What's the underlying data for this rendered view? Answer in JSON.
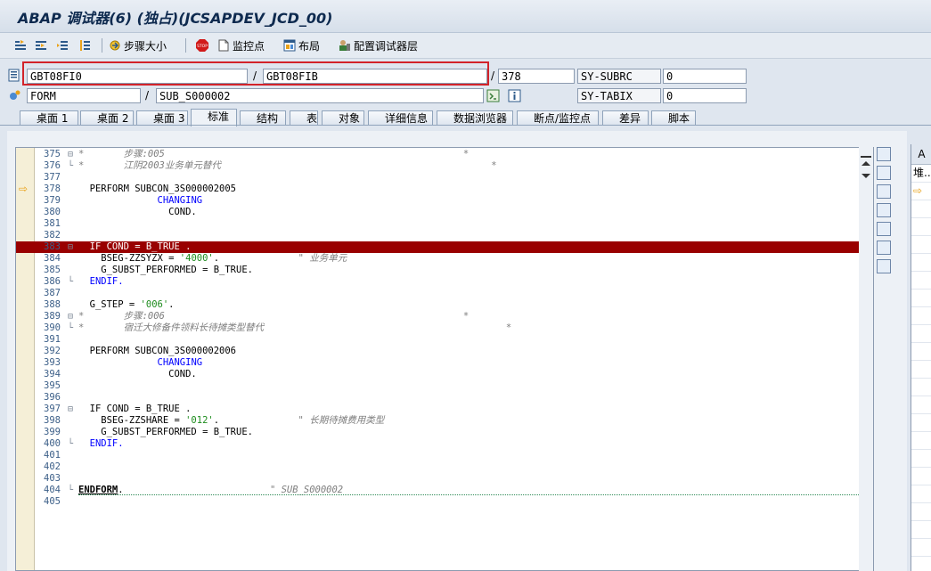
{
  "window": {
    "title": "ABAP 调试器(6) (独占)(JCSAPDEV_JCD_00)"
  },
  "toolbar": {
    "buttons": [
      {
        "label": "",
        "icon": "single-step-icon"
      },
      {
        "label": "",
        "icon": "execute-step-icon"
      },
      {
        "label": "",
        "icon": "return-icon"
      },
      {
        "label": "",
        "icon": "continue-icon"
      },
      {
        "label": "步骤大小",
        "icon": "step-size-icon"
      },
      {
        "label": "",
        "icon": "stop-icon"
      },
      {
        "label": "监控点",
        "icon": "watchpoint-icon"
      },
      {
        "label": "布局",
        "icon": "layout-icon"
      },
      {
        "label": "配置调试器层",
        "icon": "configure-layer-icon"
      }
    ]
  },
  "context": {
    "program": "GBT08FI0",
    "include": "GBT08FIB",
    "line": "378",
    "event_type": "FORM",
    "event_name": "SUB_S000002",
    "sys_fields": [
      {
        "name": "SY-SUBRC",
        "value": "0"
      },
      {
        "name": "SY-TABIX",
        "value": "0"
      }
    ]
  },
  "tabs": [
    {
      "label": "桌面 1",
      "active": false
    },
    {
      "label": "桌面 2",
      "active": false
    },
    {
      "label": "桌面 3",
      "active": false
    },
    {
      "label": "标准",
      "active": true
    },
    {
      "label": "结构",
      "active": false
    },
    {
      "label": "表",
      "active": false
    },
    {
      "label": "对象",
      "active": false
    },
    {
      "label": "详细信息",
      "active": false
    },
    {
      "label": "数据浏览器",
      "active": false
    },
    {
      "label": "断点/监控点",
      "active": false
    },
    {
      "label": "差异",
      "active": false
    },
    {
      "label": "脚本",
      "active": false
    }
  ],
  "code": {
    "current_line": 378,
    "breakpoint_line": 383,
    "highlight_line": 383,
    "lines": [
      {
        "n": "375",
        "fold": "⊟",
        "segs": [
          {
            "t": "*       步骤:005                                                     *",
            "c": "cmt"
          }
        ]
      },
      {
        "n": "376",
        "fold": "└",
        "segs": [
          {
            "t": "*       江阴2003业务单元替代                                                *",
            "c": "cmt"
          }
        ]
      },
      {
        "n": "377",
        "fold": "",
        "segs": []
      },
      {
        "n": "378",
        "fold": "",
        "segs": [
          {
            "t": "  PERFORM SUBCON_3S000002005",
            "c": ""
          }
        ]
      },
      {
        "n": "379",
        "fold": "",
        "segs": [
          {
            "t": "              ",
            "c": ""
          },
          {
            "t": "CHANGING",
            "c": "kw"
          }
        ]
      },
      {
        "n": "380",
        "fold": "",
        "segs": [
          {
            "t": "                COND.",
            "c": ""
          }
        ]
      },
      {
        "n": "381",
        "fold": "",
        "segs": []
      },
      {
        "n": "382",
        "fold": "",
        "segs": []
      },
      {
        "n": "383",
        "fold": "⊟",
        "segs": [
          {
            "t": "  IF COND = B_TRUE .",
            "c": ""
          }
        ]
      },
      {
        "n": "384",
        "fold": "",
        "segs": [
          {
            "t": "    BSEG-ZZSYZX = ",
            "c": ""
          },
          {
            "t": "'4000'",
            "c": "str"
          },
          {
            "t": ".              ",
            "c": ""
          },
          {
            "t": "\" 业务单元",
            "c": "cmt"
          }
        ]
      },
      {
        "n": "385",
        "fold": "",
        "segs": [
          {
            "t": "    G_SUBST_PERFORMED = B_TRUE.",
            "c": ""
          }
        ]
      },
      {
        "n": "386",
        "fold": "└",
        "segs": [
          {
            "t": "  ENDIF.",
            "c": "kw"
          }
        ]
      },
      {
        "n": "387",
        "fold": "",
        "segs": []
      },
      {
        "n": "388",
        "fold": "",
        "segs": [
          {
            "t": "  G_STEP = ",
            "c": ""
          },
          {
            "t": "'006'",
            "c": "str"
          },
          {
            "t": ".",
            "c": ""
          }
        ]
      },
      {
        "n": "389",
        "fold": "⊟",
        "segs": [
          {
            "t": "*       步骤:006                                                     *",
            "c": "cmt"
          }
        ]
      },
      {
        "n": "390",
        "fold": "└",
        "segs": [
          {
            "t": "*       宿迁大修备件领料长待摊类型替代                                           *",
            "c": "cmt"
          }
        ]
      },
      {
        "n": "391",
        "fold": "",
        "segs": []
      },
      {
        "n": "392",
        "fold": "",
        "segs": [
          {
            "t": "  PERFORM SUBCON_3S000002006",
            "c": ""
          }
        ]
      },
      {
        "n": "393",
        "fold": "",
        "segs": [
          {
            "t": "              ",
            "c": ""
          },
          {
            "t": "CHANGING",
            "c": "kw"
          }
        ]
      },
      {
        "n": "394",
        "fold": "",
        "segs": [
          {
            "t": "                COND.",
            "c": ""
          }
        ]
      },
      {
        "n": "395",
        "fold": "",
        "segs": []
      },
      {
        "n": "396",
        "fold": "",
        "segs": []
      },
      {
        "n": "397",
        "fold": "⊟",
        "segs": [
          {
            "t": "  IF COND = B_TRUE .",
            "c": ""
          }
        ]
      },
      {
        "n": "398",
        "fold": "",
        "segs": [
          {
            "t": "    BSEG-ZZSHARE = ",
            "c": ""
          },
          {
            "t": "'012'",
            "c": "str"
          },
          {
            "t": ".              ",
            "c": ""
          },
          {
            "t": "\" 长期待摊费用类型",
            "c": "cmt"
          }
        ]
      },
      {
        "n": "399",
        "fold": "",
        "segs": [
          {
            "t": "    G_SUBST_PERFORMED = B_TRUE.",
            "c": ""
          }
        ]
      },
      {
        "n": "400",
        "fold": "└",
        "segs": [
          {
            "t": "  ENDIF.",
            "c": "kw"
          }
        ]
      },
      {
        "n": "401",
        "fold": "",
        "segs": []
      },
      {
        "n": "402",
        "fold": "",
        "segs": []
      },
      {
        "n": "403",
        "fold": "",
        "segs": []
      },
      {
        "n": "404",
        "fold": "└",
        "segs": [
          {
            "t": "ENDFORM",
            "c": "endform"
          },
          {
            "t": ".                          ",
            "c": ""
          },
          {
            "t": "\" SUB_S000002",
            "c": "cmt"
          }
        ]
      },
      {
        "n": "405",
        "fold": "",
        "segs": []
      }
    ]
  },
  "side_panel": {
    "icons": [
      "maximize-icon",
      "new-tool-icon",
      "replace-tool-icon",
      "full-screen-icon",
      "swap-icon",
      "services-icon",
      "settings-icon"
    ]
  },
  "right_pane": {
    "header": "A",
    "rows": [
      "堆..."
    ]
  }
}
